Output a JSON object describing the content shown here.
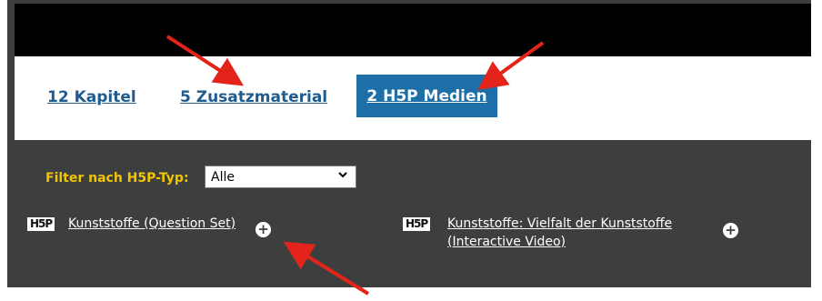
{
  "tabs": [
    {
      "label": "12 Kapitel"
    },
    {
      "label": "5 Zusatzmaterial"
    },
    {
      "label": "2 H5P Medien"
    }
  ],
  "filter": {
    "label": "Filter nach H5P-Typ:",
    "selected": "Alle"
  },
  "items": [
    {
      "badge": "H5P",
      "title": "Kunststoffe (Question Set)"
    },
    {
      "badge": "H5P",
      "title_line1": "Kunststoffe: Vielfalt der Kunststoffe",
      "title_line2": "(Interactive Video)"
    }
  ],
  "colors": {
    "accent_tab": "#1e6fa8",
    "filter_label": "#f2c500",
    "annotation_arrow": "#e3241b",
    "panel_bg": "#3d3f3f"
  }
}
